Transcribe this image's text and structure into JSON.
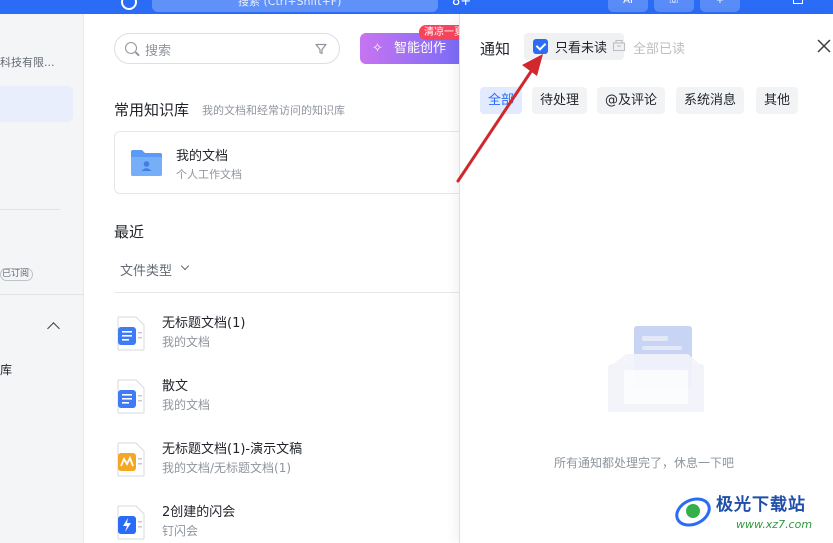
{
  "topbar": {
    "search_placeholder": "搜索 (Ctrl+Shift+F)",
    "btn1": "AI",
    "btn2": "☏",
    "btn3": "+"
  },
  "sidebar": {
    "org_name": "科技有限...",
    "tag": "已订阅",
    "kb_label": "库"
  },
  "main": {
    "search_placeholder": "搜索",
    "ai_button": "智能创作",
    "ai_badge": "清凉一夏",
    "knowledge_title": "常用知识库",
    "knowledge_subtitle": "我的文档和经常访问的知识库",
    "kb_card": {
      "name": "我的文档",
      "desc": "个人工作文档"
    },
    "recent_title": "最近",
    "file_type_filter": "文件类型",
    "files": [
      {
        "name": "无标题文档(1)",
        "path": "我的文档",
        "icon": "doc-icon",
        "color": "#3d7bf7"
      },
      {
        "name": "散文",
        "path": "我的文档",
        "icon": "doc-icon",
        "color": "#3d7bf7"
      },
      {
        "name": "无标题文档(1)-演示文稿",
        "path": "我的文档/无标题文档(1)",
        "icon": "slides-icon",
        "color": "#f5a623"
      },
      {
        "name": "2创建的闪会",
        "path": "钉闪会",
        "icon": "flash-meeting-icon",
        "color": "#2b6cf6"
      }
    ]
  },
  "panel": {
    "title": "通知",
    "unread_only": "只看未读",
    "mark_all_read": "全部已读",
    "tabs": [
      {
        "label": "全部",
        "active": true
      },
      {
        "label": "待处理",
        "active": false
      },
      {
        "label": "@及评论",
        "active": false
      },
      {
        "label": "系统消息",
        "active": false
      },
      {
        "label": "其他",
        "active": false
      }
    ],
    "empty_text": "所有通知都处理完了，休息一下吧"
  },
  "watermark": {
    "title": "极光下载站",
    "url": "www.xz7.com"
  },
  "colors": {
    "accent": "#2b6cf6",
    "arrow": "#d0282c"
  }
}
